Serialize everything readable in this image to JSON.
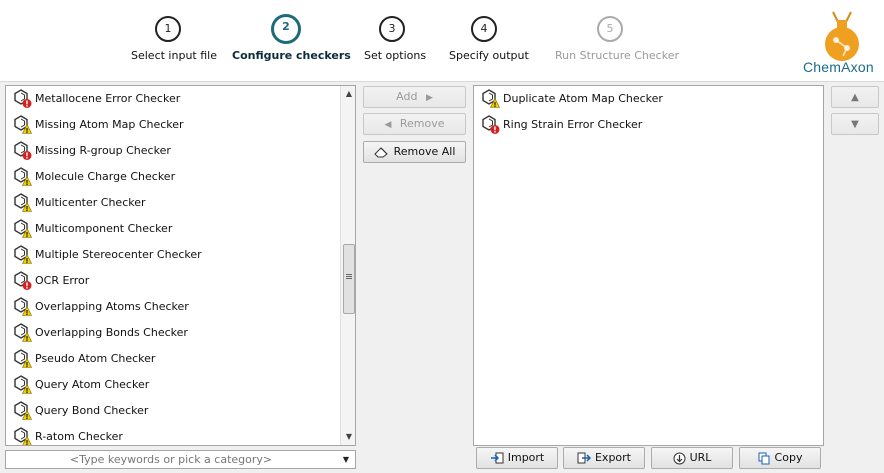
{
  "wizard": {
    "steps": [
      {
        "number": "1",
        "label": "Select input file",
        "state": "done"
      },
      {
        "number": "2",
        "label": "Configure checkers",
        "state": "active"
      },
      {
        "number": "3",
        "label": "Set options",
        "state": "pending"
      },
      {
        "number": "4",
        "label": "Specify output",
        "state": "pending"
      },
      {
        "number": "5",
        "label": "Run Structure Checker",
        "state": "disabled"
      }
    ]
  },
  "brand": {
    "name": "ChemAxon",
    "logo_icon": "flask-molecule-logo",
    "color": "#1d6b8a",
    "accent": "#f0a020"
  },
  "available_checkers": {
    "items": [
      {
        "label": "Metallocene Error Checker",
        "severity": "error"
      },
      {
        "label": "Missing Atom Map Checker",
        "severity": "warning"
      },
      {
        "label": "Missing R-group Checker",
        "severity": "error"
      },
      {
        "label": "Molecule Charge Checker",
        "severity": "warning"
      },
      {
        "label": "Multicenter Checker",
        "severity": "warning"
      },
      {
        "label": "Multicomponent Checker",
        "severity": "warning"
      },
      {
        "label": "Multiple Stereocenter Checker",
        "severity": "warning"
      },
      {
        "label": "OCR Error",
        "severity": "error"
      },
      {
        "label": "Overlapping Atoms Checker",
        "severity": "warning"
      },
      {
        "label": "Overlapping Bonds Checker",
        "severity": "warning"
      },
      {
        "label": "Pseudo Atom Checker",
        "severity": "warning"
      },
      {
        "label": "Query Atom Checker",
        "severity": "warning"
      },
      {
        "label": "Query Bond Checker",
        "severity": "warning"
      },
      {
        "label": "R-atom Checker",
        "severity": "warning"
      }
    ]
  },
  "selected_checkers": {
    "items": [
      {
        "label": "Duplicate Atom Map Checker",
        "severity": "warning"
      },
      {
        "label": "Ring Strain Error Checker",
        "severity": "error"
      }
    ]
  },
  "search": {
    "placeholder": "<Type keywords or pick a category>"
  },
  "actions": {
    "add": "Add",
    "remove": "Remove",
    "remove_all": "Remove All",
    "import": "Import",
    "export": "Export",
    "url": "URL",
    "copy": "Copy"
  },
  "colors": {
    "error": "#d42020",
    "warning": "#f2d000",
    "active_step": "#1d6b7a"
  }
}
